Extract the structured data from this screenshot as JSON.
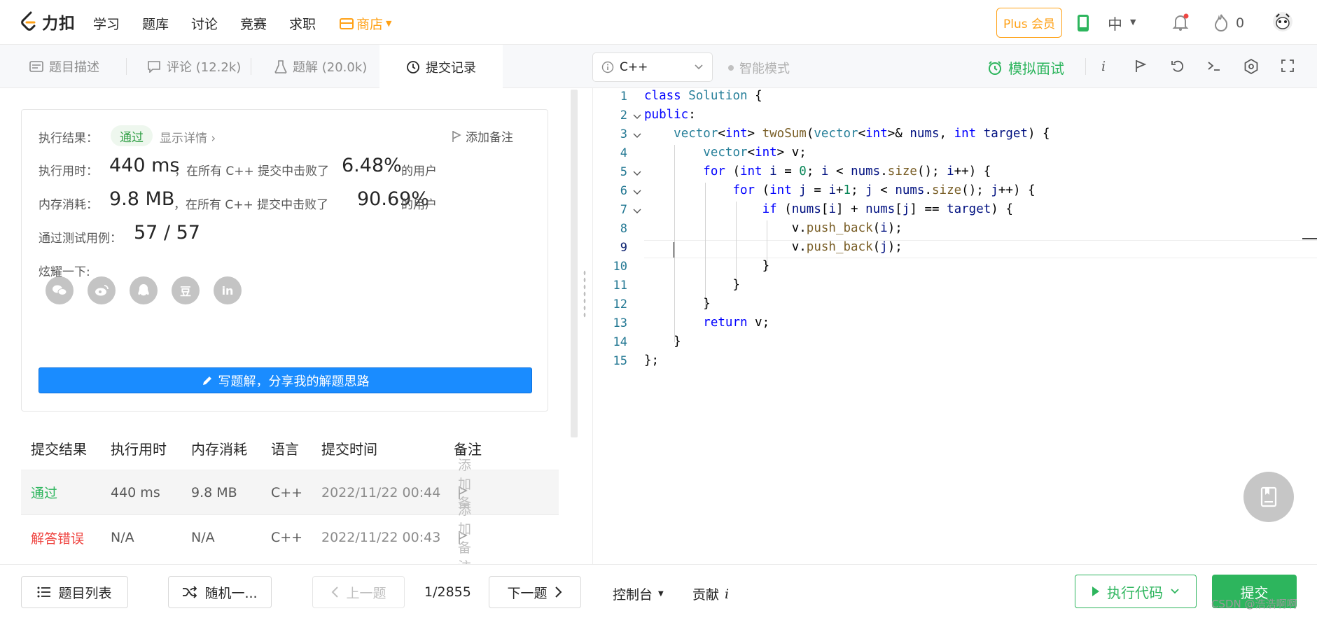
{
  "nav": {
    "logo_text": "力扣",
    "items": [
      "学习",
      "题库",
      "讨论",
      "竞赛",
      "求职"
    ],
    "store": "商店",
    "plus": "Plus 会员",
    "lang": "中",
    "points": "0"
  },
  "tabs": {
    "description": "题目描述",
    "comments": "评论 (12.2k)",
    "solutions": "题解 (20.0k)",
    "submissions": "提交记录"
  },
  "editor_toolbar": {
    "language": "C++",
    "ai_mode": "智能模式",
    "interview": "模拟面试"
  },
  "result": {
    "status_label": "执行结果：",
    "status": "通过",
    "details": "显示详情 ›",
    "add_note": "添加备注",
    "time_label": "执行用时：",
    "time_value": "440 ms",
    "time_desc": "，在所有 C++ 提交中击败了",
    "time_pct": "6.48%",
    "time_suffix": "的用户",
    "mem_label": "内存消耗：",
    "mem_value": "9.8 MB",
    "mem_desc": "，在所有 C++ 提交中击败了",
    "mem_pct": "90.69%",
    "mem_suffix": "的用户",
    "cases_label": "通过测试用例：",
    "cases_value": "57 / 57",
    "share_label": "炫耀一下:",
    "share_icons": [
      "wechat-icon",
      "weibo-icon",
      "qq-icon",
      "douban-icon",
      "linkedin-icon"
    ],
    "share_glyphs": [
      "",
      "",
      "",
      "豆",
      "in"
    ],
    "write_button": "写题解，分享我的解题思路"
  },
  "submissions": {
    "headers": [
      "提交结果",
      "执行用时",
      "内存消耗",
      "语言",
      "提交时间",
      "备注"
    ],
    "rows": [
      {
        "status": "通过",
        "time": "440 ms",
        "memory": "9.8 MB",
        "lang": "C++",
        "submitted": "2022/11/22 00:44",
        "note": "添加备注"
      },
      {
        "status": "解答错误",
        "time": "N/A",
        "memory": "N/A",
        "lang": "C++",
        "submitted": "2022/11/22 00:43",
        "note": "添加备注"
      }
    ]
  },
  "code": {
    "line_numbers": [
      "1",
      "2",
      "3",
      "4",
      "5",
      "6",
      "7",
      "8",
      "9",
      "10",
      "11",
      "12",
      "13",
      "14",
      "15"
    ],
    "lines": [
      "class Solution {",
      "public:",
      "    vector<int> twoSum(vector<int>& nums, int target) {",
      "        vector<int> v;",
      "        for (int i = 0; i < nums.size(); i++) {",
      "            for (int j = i+1; j < nums.size(); j++) {",
      "                if (nums[i] + nums[j] == target) {",
      "                    v.push_back(i);",
      "                    v.push_back(j);",
      "                }",
      "            }",
      "        }",
      "        return v;",
      "    }",
      "};"
    ]
  },
  "bottom": {
    "problem_list": "题目列表",
    "random": "随机一...",
    "prev": "上一题",
    "page": "1/2855",
    "next": "下一题",
    "console": "控制台",
    "contribute": "贡献",
    "run": "执行代码",
    "submit": "提交"
  },
  "watermark": "CSDN @浩浩啊啊",
  "colors": {
    "accent_orange": "#ffa116",
    "success_green": "#2db55d",
    "error_red": "#ef4743",
    "primary_blue": "#1a8cff"
  }
}
